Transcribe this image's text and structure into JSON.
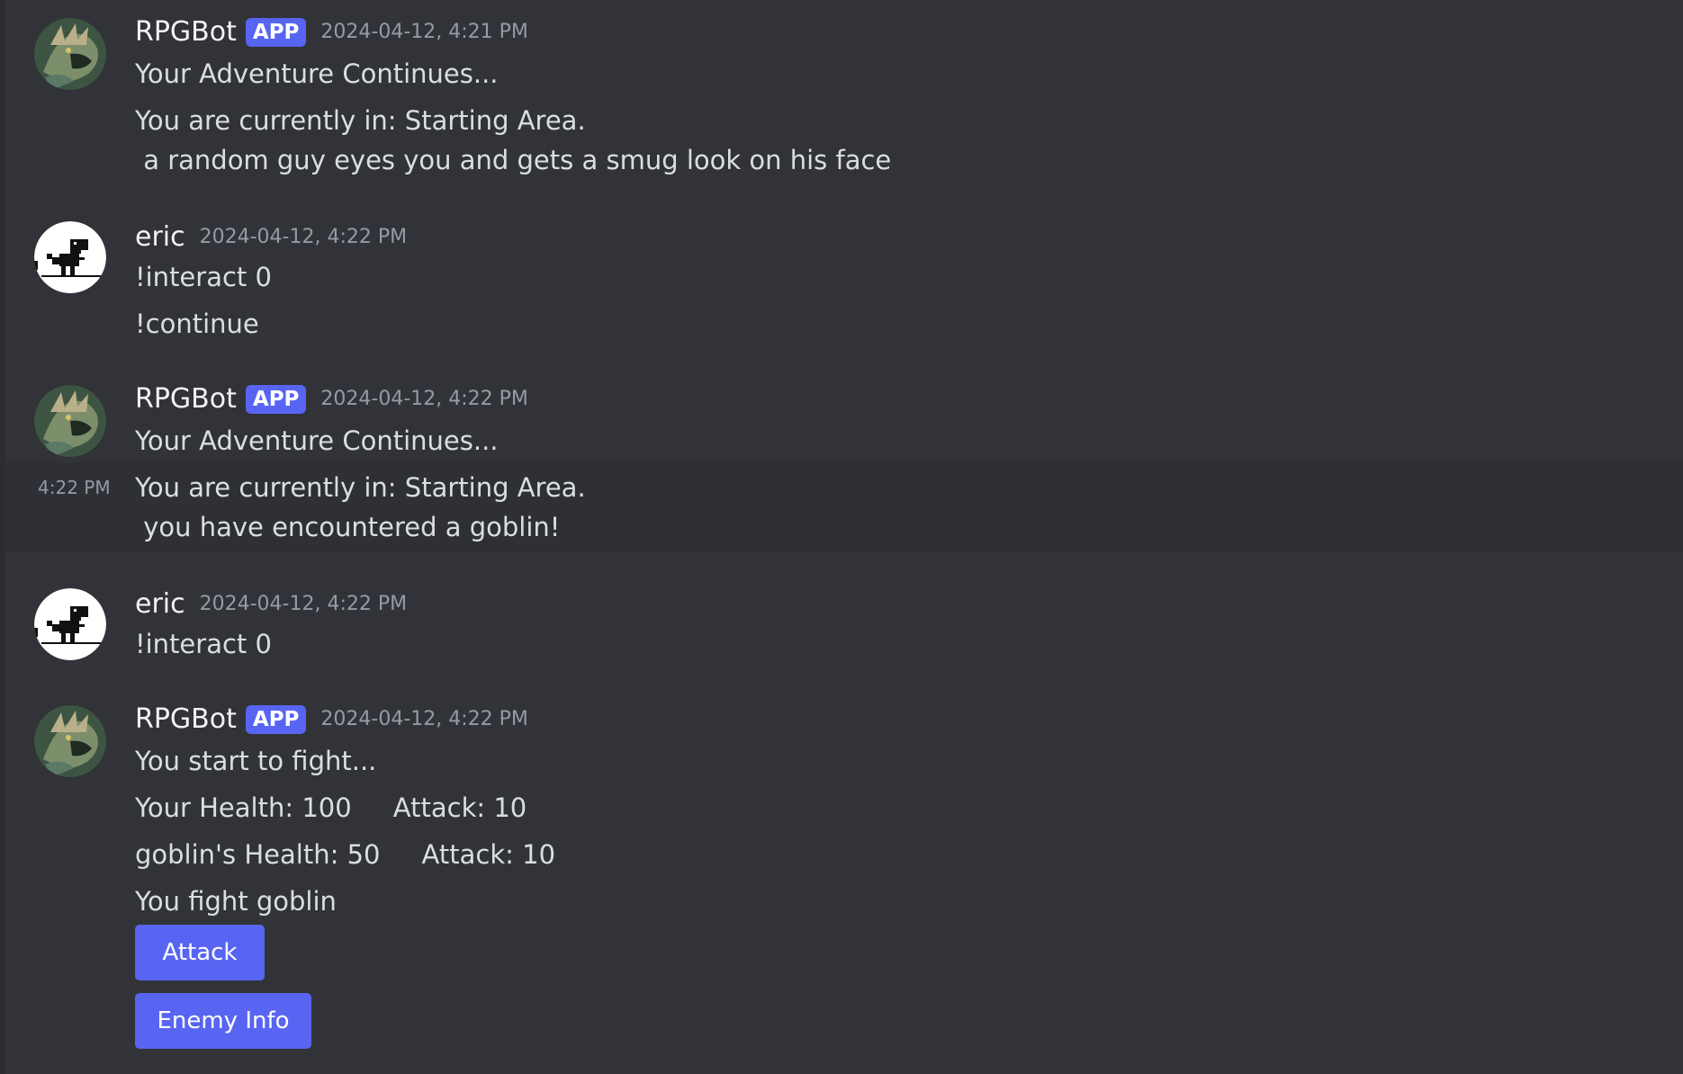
{
  "messages": [
    {
      "author": "RPGBot",
      "tag": "APP",
      "timestamp": "2024-04-12, 4:21 PM",
      "lines": [
        "Your Adventure Continues...",
        "You are currently in: Starting Area.",
        " a random guy eyes you and gets a smug look on his face"
      ]
    },
    {
      "author": "eric",
      "timestamp": "2024-04-12, 4:22 PM",
      "lines": [
        "!interact 0",
        "!continue"
      ]
    },
    {
      "author": "RPGBot",
      "tag": "APP",
      "timestamp": "2024-04-12, 4:22 PM",
      "hover_time": "4:22 PM",
      "lines": [
        "Your Adventure Continues...",
        "You are currently in: Starting Area.",
        " you have encountered a goblin!"
      ]
    },
    {
      "author": "eric",
      "timestamp": "2024-04-12, 4:22 PM",
      "lines": [
        "!interact 0"
      ]
    },
    {
      "author": "RPGBot",
      "tag": "APP",
      "timestamp": "2024-04-12, 4:22 PM",
      "lines": [
        "You start to fight...",
        "Your Health: 100     Attack: 10",
        "goblin's Health: 50     Attack: 10",
        "You fight goblin"
      ],
      "buttons": [
        "Attack",
        "Enemy Info"
      ]
    }
  ],
  "colors": {
    "background": "#313338",
    "accent": "#5865f2",
    "text": "#dbdee1",
    "muted": "#949ba4"
  },
  "icons": {
    "bot_avatar": "dragon-avatar-icon",
    "user_avatar": "dino-avatar-icon"
  }
}
